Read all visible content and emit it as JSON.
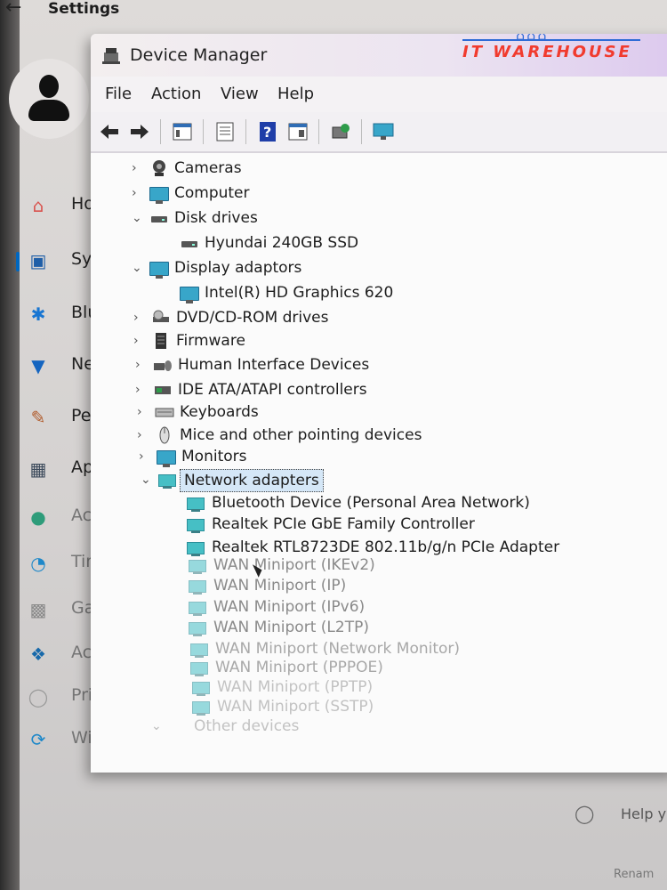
{
  "settings": {
    "back_glyph": "←",
    "title": "Settings",
    "nav": [
      {
        "label": "Ho",
        "icon": "home-icon",
        "color": "#d9534f"
      },
      {
        "label": "Sys",
        "icon": "laptop-icon",
        "color": "#1f5fa8"
      },
      {
        "label": "Blu",
        "icon": "bluetooth-icon",
        "color": "#1976d2"
      },
      {
        "label": "Ne",
        "icon": "wifi-icon",
        "color": "#1565c0"
      },
      {
        "label": "Per",
        "icon": "brush-icon",
        "color": "#b05a2a"
      },
      {
        "label": "Ap",
        "icon": "apps-icon",
        "color": "#3d4b5c"
      },
      {
        "label": "Acc",
        "icon": "accounts-icon",
        "color": "#2e9c7a"
      },
      {
        "label": "Tim",
        "icon": "globe-clock-icon",
        "color": "#1e88c9"
      },
      {
        "label": "Ga",
        "icon": "gamepad-icon",
        "color": "#8a8a8a"
      },
      {
        "label": "Acc",
        "icon": "accessibility-icon",
        "color": "#1769aa"
      },
      {
        "label": "Pri",
        "icon": "shield-icon",
        "color": "#9a9a9a"
      },
      {
        "label": "Wi",
        "icon": "windows-update-icon",
        "color": "#1e88c9"
      }
    ],
    "help_label": "Help y",
    "bottom_text": "Renam"
  },
  "device_manager": {
    "title": "Device Manager",
    "brand": "IT WAREHOUSE",
    "menu": [
      "File",
      "Action",
      "View",
      "Help"
    ],
    "toolbar_icons": [
      "back-arrow-icon",
      "forward-arrow-icon",
      "properties-icon",
      "update-driver-icon",
      "help-icon",
      "show-hidden-icon",
      "scan-hardware-icon",
      "monitor-icon"
    ],
    "categories": [
      {
        "label": "Cameras",
        "expanded": false,
        "icon": "camera-icon"
      },
      {
        "label": "Computer",
        "expanded": false,
        "icon": "computer-icon"
      },
      {
        "label": "Disk drives",
        "expanded": true,
        "icon": "disk-drive-icon"
      },
      {
        "label": "Hyundai 240GB SSD",
        "child": true,
        "icon": "disk-drive-icon"
      },
      {
        "label": "Display adaptors",
        "expanded": true,
        "icon": "display-adapter-icon"
      },
      {
        "label": "Intel(R) HD Graphics 620",
        "child": true,
        "icon": "display-adapter-icon"
      },
      {
        "label": "DVD/CD-ROM drives",
        "expanded": false,
        "icon": "dvd-drive-icon"
      },
      {
        "label": "Firmware",
        "expanded": false,
        "icon": "firmware-icon"
      },
      {
        "label": "Human Interface Devices",
        "expanded": false,
        "icon": "hid-icon"
      },
      {
        "label": "IDE ATA/ATAPI controllers",
        "expanded": false,
        "icon": "ide-controller-icon"
      },
      {
        "label": "Keyboards",
        "expanded": false,
        "icon": "keyboard-icon"
      },
      {
        "label": "Mice and other pointing devices",
        "expanded": false,
        "icon": "mouse-icon"
      },
      {
        "label": "Monitors",
        "expanded": false,
        "icon": "monitor-icon"
      },
      {
        "label": "Network adapters",
        "expanded": true,
        "selected": true,
        "icon": "network-adapter-icon"
      }
    ],
    "network_adapters": [
      "Bluetooth Device (Personal Area Network)",
      "Realtek PCIe GbE Family Controller",
      "Realtek RTL8723DE 802.11b/g/n PCIe Adapter",
      "WAN Miniport (IKEv2)",
      "WAN Miniport (IP)",
      "WAN Miniport (IPv6)",
      "WAN Miniport (L2TP)",
      "WAN Miniport (Network Monitor)",
      "WAN Miniport (PPPOE)",
      "WAN Miniport (PPTP)",
      "WAN Miniport (SSTP)"
    ],
    "next_category": "Other devices",
    "colors": {
      "accent": "#0067c0",
      "brand_red": "#f13b2e",
      "brand_blue": "#2e6bd6"
    }
  }
}
